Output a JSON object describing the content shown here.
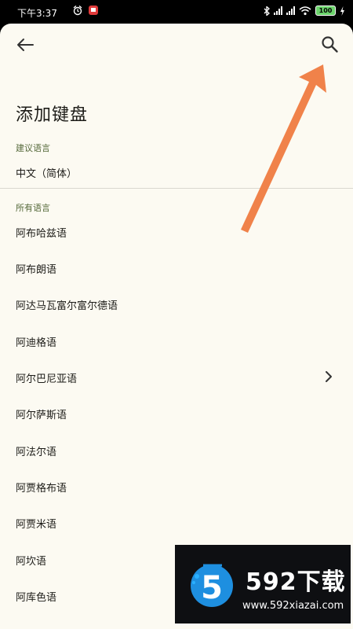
{
  "status": {
    "time": "下午3:37",
    "battery": "100"
  },
  "header": {
    "back_icon": "arrow-left-icon",
    "search_icon": "search-icon"
  },
  "page": {
    "title": "添加键盘",
    "suggested_label": "建议语言",
    "suggested_items": [
      "中文（简体）"
    ],
    "all_label": "所有语言",
    "languages": [
      "阿布哈兹语",
      "阿布朗语",
      "阿达马瓦富尔富尔德语",
      "阿迪格语",
      "阿尔巴尼亚语",
      "阿尔萨斯语",
      "阿法尔语",
      "阿贾格布语",
      "阿贾米语",
      "阿坎语",
      "阿库色语"
    ]
  },
  "colors": {
    "background": "#fcfaf2",
    "section_label": "#55693a",
    "annotation_arrow": "#f0824a"
  },
  "watermark": {
    "brand": "592下载",
    "url": "www.592xiazai.com"
  }
}
